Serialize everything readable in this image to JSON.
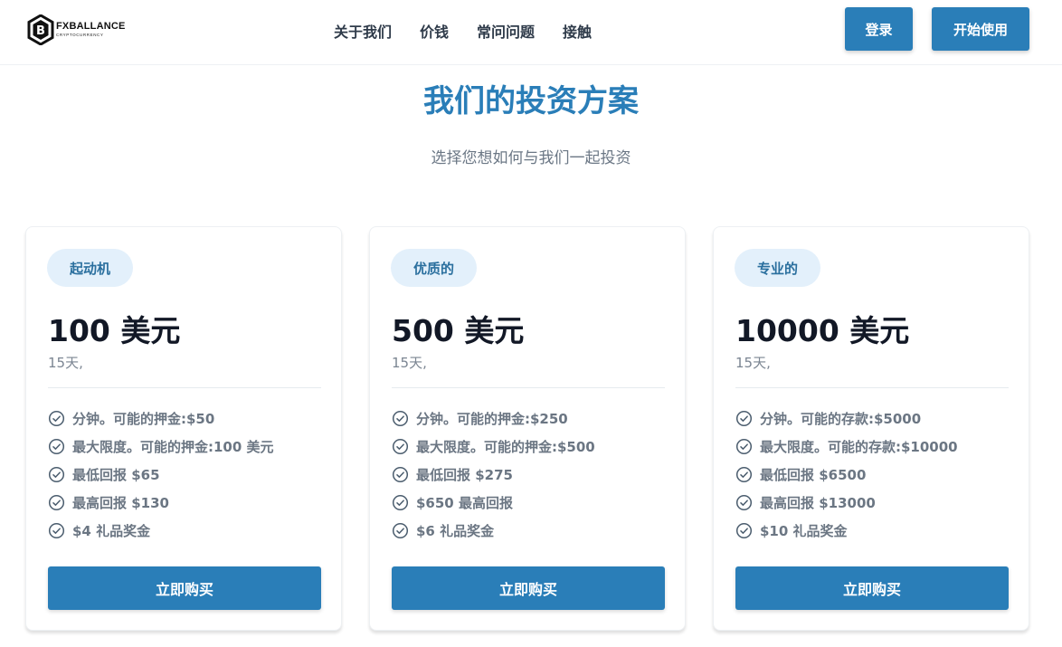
{
  "brand": {
    "name": "FXBALLANCE",
    "tagline": "CRYPTOCURRENCY"
  },
  "nav": [
    "关于我们",
    "价钱",
    "常问问题",
    "接触"
  ],
  "header_buttons": {
    "login": "登录",
    "start": "开始使用"
  },
  "hero": {
    "title": "我们的投资方案",
    "subtitle": "选择您想如何与我们一起投资"
  },
  "plans": [
    {
      "badge": "起动机",
      "price": "100 美元",
      "duration": "15天,",
      "features": [
        "分钟。可能的押金:$50",
        "最大限度。可能的押金:100 美元",
        "最低回报 $65",
        "最高回报 $130",
        "$4 礼品奖金"
      ],
      "button": "立即购买"
    },
    {
      "badge": "优质的",
      "price": "500 美元",
      "duration": "15天,",
      "features": [
        "分钟。可能的押金:$250",
        "最大限度。可能的押金:$500",
        "最低回报 $275",
        "$650 最高回报",
        "$6 礼品奖金"
      ],
      "button": "立即购买"
    },
    {
      "badge": "专业的",
      "price": "10000 美元",
      "duration": "15天,",
      "features": [
        "分钟。可能的存款:$5000",
        "最大限度。可能的存款:$10000",
        "最低回报 $6500",
        "最高回报 $13000",
        "$10 礼品奖金"
      ],
      "button": "立即购买"
    }
  ],
  "colors": {
    "accent": "#2a7eb8",
    "badge_bg": "#e3f0fb",
    "heading": "#2a7eb8"
  },
  "icons": {
    "feature": "check-circle-icon",
    "logo": "bitcoin-hexagon-icon"
  }
}
